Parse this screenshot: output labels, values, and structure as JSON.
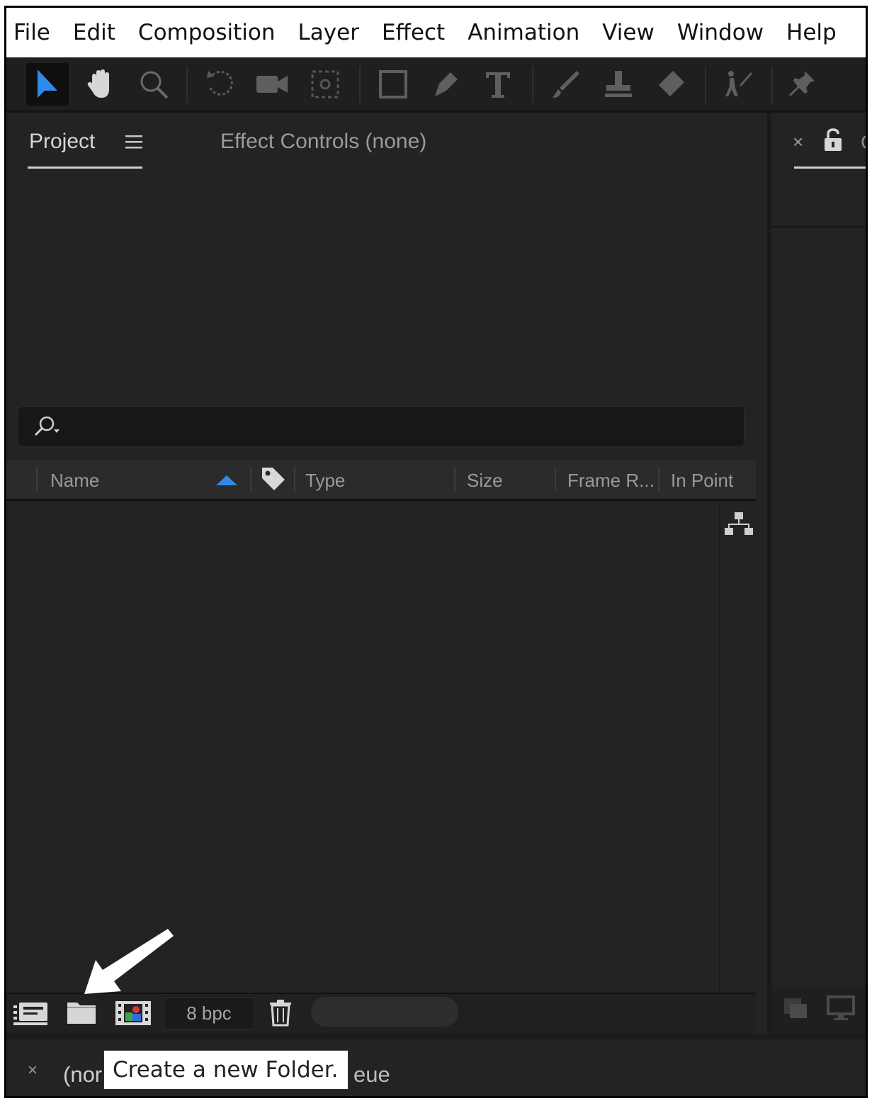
{
  "menu": [
    "File",
    "Edit",
    "Composition",
    "Layer",
    "Effect",
    "Animation",
    "View",
    "Window",
    "Help"
  ],
  "toolbar": {
    "tools": [
      "selection-tool-icon",
      "hand-tool-icon",
      "zoom-tool-icon",
      "rotation-tool-icon",
      "camera-tool-icon",
      "pan-behind-tool-icon",
      "rectangle-tool-icon",
      "pen-tool-icon",
      "type-tool-icon",
      "brush-tool-icon",
      "clone-stamp-tool-icon",
      "eraser-tool-icon",
      "roto-brush-tool-icon",
      "puppet-pin-tool-icon"
    ]
  },
  "project_panel": {
    "tab_project": "Project",
    "tab_effect_controls": "Effect Controls (none)",
    "columns": [
      "Name",
      "Type",
      "Size",
      "Frame R...",
      "In Point"
    ],
    "bpc_label": "8 bpc"
  },
  "right_panel": {
    "tab_partial": "C"
  },
  "bottom": {
    "tab_partial": "(nor",
    "queue_partial": "eue",
    "tooltip": "Create a new Folder."
  },
  "colors": {
    "accent": "#2d8ceb",
    "panel_bg": "#232323"
  }
}
